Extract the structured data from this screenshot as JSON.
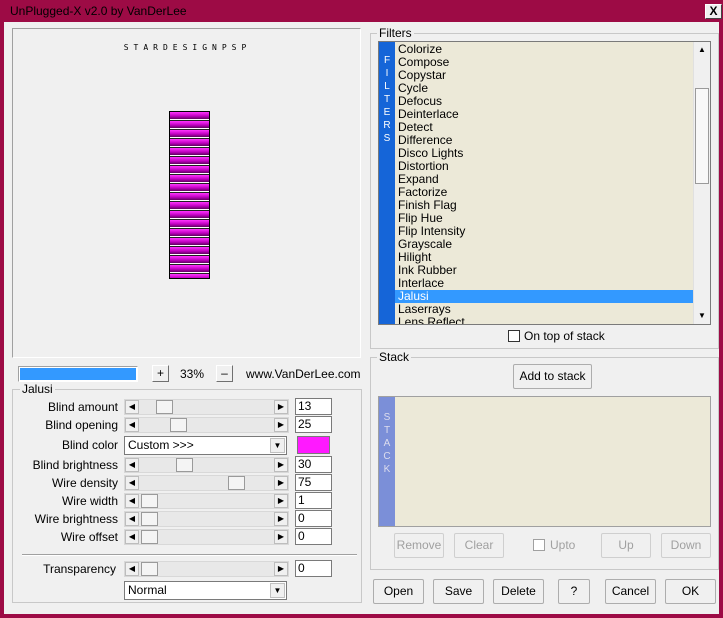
{
  "window": {
    "title": "UnPlugged-X v2.0 by VanDerLee",
    "close_glyph": "X"
  },
  "preview": {
    "watermark": "STARDESIGNPSP",
    "zoom": "33%",
    "zoom_plus": "+",
    "zoom_minus": "–",
    "website": "www.VanDerLee.com"
  },
  "jalusi": {
    "group_label": "Jalusi",
    "params": [
      {
        "label": "Blind amount",
        "value": "13",
        "level": 0.13
      },
      {
        "label": "Blind opening",
        "value": "25",
        "level": 0.25
      },
      {
        "label": "Blind brightness",
        "value": "30",
        "level": 0.3
      },
      {
        "label": "Wire density",
        "value": "75",
        "level": 0.75
      },
      {
        "label": "Wire width",
        "value": "1",
        "level": 0.0
      },
      {
        "label": "Wire brightness",
        "value": "0",
        "level": 0.0
      },
      {
        "label": "Wire offset",
        "value": "0",
        "level": 0.0
      }
    ],
    "blind_color": {
      "label": "Blind color",
      "value": "Custom >>>",
      "swatch": "#ff19ff"
    },
    "transparency": {
      "label": "Transparency",
      "value": "0",
      "level": 0.0
    },
    "blend_mode": "Normal"
  },
  "filters": {
    "group_label": "Filters",
    "side_label": "FILTERS",
    "items": [
      "Colorize",
      "Compose",
      "Copystar",
      "Cycle",
      "Defocus",
      "Deinterlace",
      "Detect",
      "Difference",
      "Disco Lights",
      "Distortion",
      "Expand",
      "Factorize",
      "Finish Flag",
      "Flip Hue",
      "Flip Intensity",
      "Grayscale",
      "Hilight",
      "Ink Rubber",
      "Interlace",
      "Jalusi",
      "Laserrays",
      "Lens Reflect"
    ],
    "selected": "Jalusi",
    "on_top_label": "On top of stack"
  },
  "stack": {
    "group_label": "Stack",
    "side_label": "STACK",
    "add_label": "Add to stack",
    "remove_label": "Remove",
    "clear_label": "Clear",
    "upto_label": "Upto",
    "up_label": "Up",
    "down_label": "Down"
  },
  "bottom": {
    "open": "Open",
    "save": "Save",
    "delete": "Delete",
    "help": "?",
    "cancel": "Cancel",
    "ok": "OK"
  },
  "colors": {
    "titlebar": "#9d0b45",
    "selection": "#3399ff",
    "side_panel": "#1565d8",
    "stack_panel": "#7b8fd8"
  }
}
